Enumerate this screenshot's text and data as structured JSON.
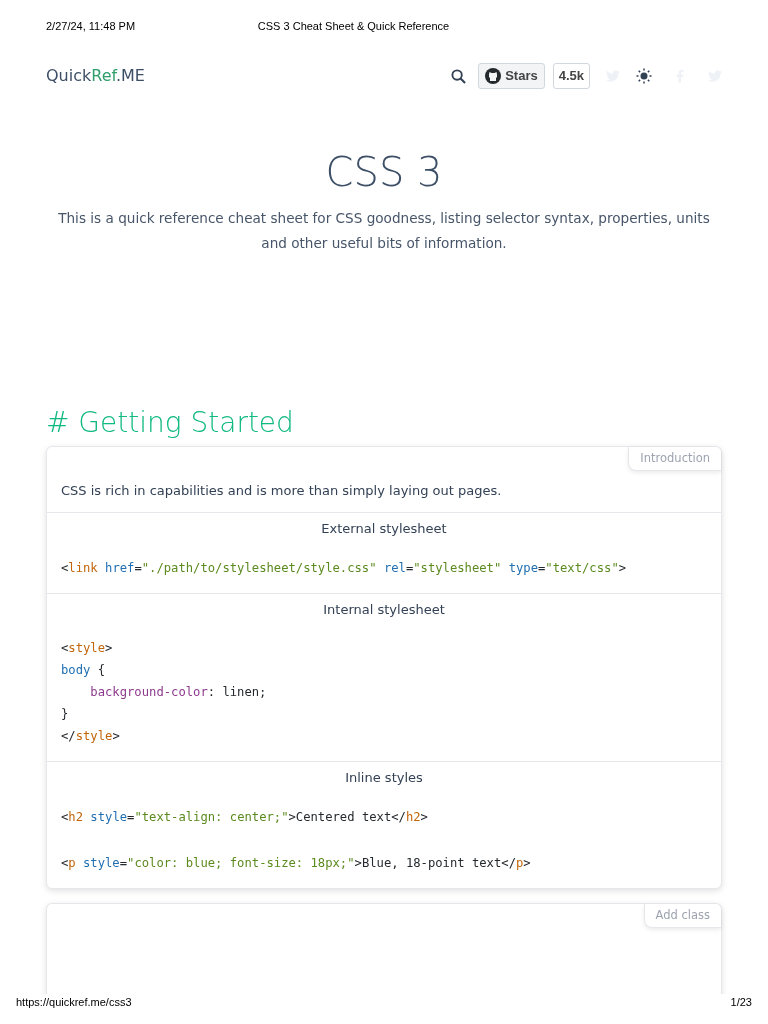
{
  "print_header": {
    "date": "2/27/24, 11:48 PM",
    "title": "CSS 3 Cheat Sheet & Quick Reference"
  },
  "navbar": {
    "logo": [
      {
        "kind": "plain",
        "text": "Quick"
      },
      {
        "kind": "accent",
        "text": "Ref"
      },
      {
        "kind": "plain",
        "text": ".ME"
      }
    ],
    "stars_label": "Stars",
    "stars_count": "4.5k"
  },
  "hero": {
    "title": "CSS 3",
    "description": "This is a quick reference cheat sheet for CSS goodness, listing selector syntax, properties, units and other useful bits of information."
  },
  "section": {
    "heading": "# Getting Started",
    "cards": [
      {
        "tag": "Introduction",
        "intro": "CSS is rich in capabilities and is more than simply laying out pages.",
        "blocks": [
          {
            "caption": "External stylesheet",
            "snippets": [
              [
                [
                  {
                    "kind": "punct",
                    "text": "<"
                  },
                  {
                    "kind": "tag",
                    "text": "link"
                  },
                  {
                    "kind": "attr",
                    "text": " href"
                  },
                  {
                    "kind": "punct",
                    "text": "="
                  },
                  {
                    "kind": "str",
                    "text": "\"./path/to/stylesheet/style.css\""
                  },
                  {
                    "kind": "attr",
                    "text": " rel"
                  },
                  {
                    "kind": "punct",
                    "text": "="
                  },
                  {
                    "kind": "str",
                    "text": "\"stylesheet\""
                  },
                  {
                    "kind": "attr",
                    "text": " type"
                  },
                  {
                    "kind": "punct",
                    "text": "="
                  },
                  {
                    "kind": "str",
                    "text": "\"text/css\""
                  },
                  {
                    "kind": "punct",
                    "text": ">"
                  }
                ]
              ]
            ]
          },
          {
            "caption": "Internal stylesheet",
            "snippets": [
              [
                [
                  {
                    "kind": "punct",
                    "text": "<"
                  },
                  {
                    "kind": "tag",
                    "text": "style"
                  },
                  {
                    "kind": "punct",
                    "text": ">"
                  }
                ],
                [
                  {
                    "kind": "attr",
                    "text": "body"
                  },
                  {
                    "kind": "plain",
                    "text": " {"
                  }
                ],
                [
                  {
                    "kind": "prop",
                    "text": "    background-color"
                  },
                  {
                    "kind": "plain",
                    "text": ": linen;"
                  }
                ],
                [
                  {
                    "kind": "plain",
                    "text": "}"
                  }
                ],
                [
                  {
                    "kind": "punct",
                    "text": "</"
                  },
                  {
                    "kind": "tag",
                    "text": "style"
                  },
                  {
                    "kind": "punct",
                    "text": ">"
                  }
                ]
              ]
            ]
          },
          {
            "caption": "Inline styles",
            "snippets": [
              [
                [
                  {
                    "kind": "punct",
                    "text": "<"
                  },
                  {
                    "kind": "tag",
                    "text": "h2"
                  },
                  {
                    "kind": "attr",
                    "text": " style"
                  },
                  {
                    "kind": "punct",
                    "text": "="
                  },
                  {
                    "kind": "str",
                    "text": "\"text-align: center;\""
                  },
                  {
                    "kind": "punct",
                    "text": ">"
                  },
                  {
                    "kind": "plain",
                    "text": "Centered text"
                  },
                  {
                    "kind": "punct",
                    "text": "</"
                  },
                  {
                    "kind": "tag",
                    "text": "h2"
                  },
                  {
                    "kind": "punct",
                    "text": ">"
                  }
                ]
              ],
              [
                [
                  {
                    "kind": "punct",
                    "text": "<"
                  },
                  {
                    "kind": "tag",
                    "text": "p"
                  },
                  {
                    "kind": "attr",
                    "text": " style"
                  },
                  {
                    "kind": "punct",
                    "text": "="
                  },
                  {
                    "kind": "str",
                    "text": "\"color: blue; font-size: 18px;\""
                  },
                  {
                    "kind": "punct",
                    "text": ">"
                  },
                  {
                    "kind": "plain",
                    "text": "Blue, 18-point text"
                  },
                  {
                    "kind": "punct",
                    "text": "</"
                  },
                  {
                    "kind": "tag",
                    "text": "p"
                  },
                  {
                    "kind": "punct",
                    "text": ">"
                  }
                ]
              ]
            ]
          }
        ]
      },
      {
        "tag": "Add class"
      }
    ]
  },
  "print_footer": {
    "url": "https://quickref.me/css3",
    "page": "1/23"
  }
}
